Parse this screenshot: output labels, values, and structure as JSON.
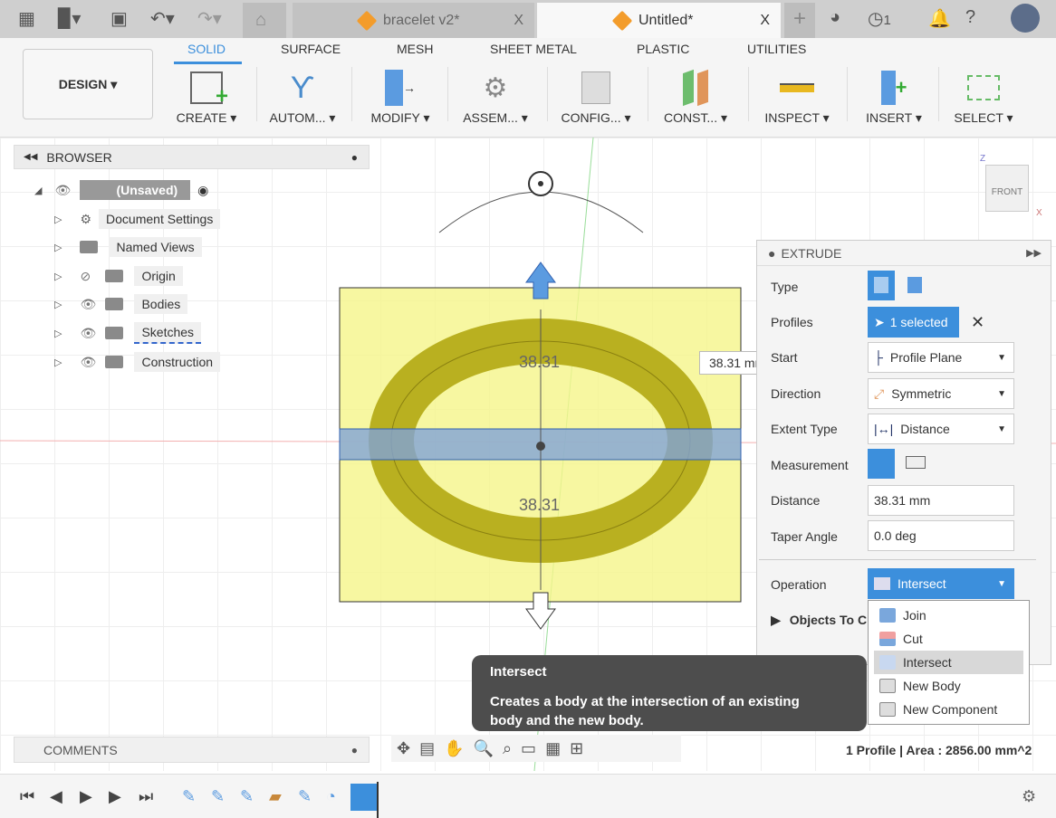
{
  "tabs": [
    {
      "label": "bracelet v2*",
      "close": "X"
    },
    {
      "label": "Untitled*",
      "close": "X"
    }
  ],
  "topbar": {
    "jobs_count": "1"
  },
  "workspace": {
    "label": "DESIGN ▾"
  },
  "workspace_tabs": [
    "SOLID",
    "SURFACE",
    "MESH",
    "SHEET METAL",
    "PLASTIC",
    "UTILITIES"
  ],
  "tools": [
    "CREATE ▾",
    "AUTOM... ▾",
    "MODIFY ▾",
    "ASSEM... ▾",
    "CONFIG... ▾",
    "CONST... ▾",
    "INSPECT ▾",
    "INSERT ▾",
    "SELECT ▾"
  ],
  "browser": {
    "title": "BROWSER",
    "root": "(Unsaved)",
    "items": [
      "Document Settings",
      "Named Views",
      "Origin",
      "Bodies",
      "Sketches",
      "Construction"
    ]
  },
  "viewport": {
    "dim_top": "38.31",
    "dim_bottom": "38.31",
    "dim_input": "38.31 mm",
    "viewcube": "FRONT",
    "axis_z": "Z",
    "axis_x": "X"
  },
  "extrude": {
    "title": "EXTRUDE",
    "labels": {
      "type": "Type",
      "profiles": "Profiles",
      "start": "Start",
      "direction": "Direction",
      "extent": "Extent Type",
      "measurement": "Measurement",
      "distance": "Distance",
      "taper": "Taper Angle",
      "operation": "Operation",
      "objects": "Objects To Cut"
    },
    "profiles_value": "1 selected",
    "start_value": "Profile Plane",
    "direction_value": "Symmetric",
    "extent_value": "Distance",
    "distance_value": "38.31 mm",
    "taper_value": "0.0 deg",
    "operation_value": "Intersect"
  },
  "operation_menu": [
    "Join",
    "Cut",
    "Intersect",
    "New Body",
    "New Component"
  ],
  "tooltip": {
    "title": "Intersect",
    "body": "Creates a body at the intersection of an existing body and the new body."
  },
  "comments": {
    "label": "COMMENTS"
  },
  "status": "1 Profile | Area : 2856.00 mm^2",
  "colors": {
    "accent": "#3c8fdc",
    "extrude_box": "#f5f58a",
    "ring": "#b9b020"
  }
}
